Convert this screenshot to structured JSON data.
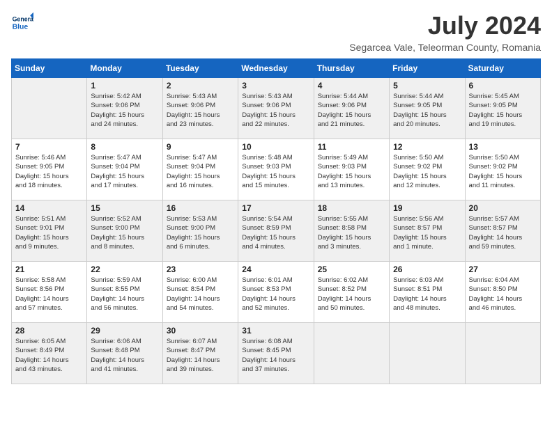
{
  "header": {
    "logo_line1": "General",
    "logo_line2": "Blue",
    "month_year": "July 2024",
    "location": "Segarcea Vale, Teleorman County, Romania"
  },
  "columns": [
    "Sunday",
    "Monday",
    "Tuesday",
    "Wednesday",
    "Thursday",
    "Friday",
    "Saturday"
  ],
  "weeks": [
    {
      "days": [
        {
          "number": "",
          "info": ""
        },
        {
          "number": "1",
          "info": "Sunrise: 5:42 AM\nSunset: 9:06 PM\nDaylight: 15 hours\nand 24 minutes."
        },
        {
          "number": "2",
          "info": "Sunrise: 5:43 AM\nSunset: 9:06 PM\nDaylight: 15 hours\nand 23 minutes."
        },
        {
          "number": "3",
          "info": "Sunrise: 5:43 AM\nSunset: 9:06 PM\nDaylight: 15 hours\nand 22 minutes."
        },
        {
          "number": "4",
          "info": "Sunrise: 5:44 AM\nSunset: 9:06 PM\nDaylight: 15 hours\nand 21 minutes."
        },
        {
          "number": "5",
          "info": "Sunrise: 5:44 AM\nSunset: 9:05 PM\nDaylight: 15 hours\nand 20 minutes."
        },
        {
          "number": "6",
          "info": "Sunrise: 5:45 AM\nSunset: 9:05 PM\nDaylight: 15 hours\nand 19 minutes."
        }
      ]
    },
    {
      "days": [
        {
          "number": "7",
          "info": "Sunrise: 5:46 AM\nSunset: 9:05 PM\nDaylight: 15 hours\nand 18 minutes."
        },
        {
          "number": "8",
          "info": "Sunrise: 5:47 AM\nSunset: 9:04 PM\nDaylight: 15 hours\nand 17 minutes."
        },
        {
          "number": "9",
          "info": "Sunrise: 5:47 AM\nSunset: 9:04 PM\nDaylight: 15 hours\nand 16 minutes."
        },
        {
          "number": "10",
          "info": "Sunrise: 5:48 AM\nSunset: 9:03 PM\nDaylight: 15 hours\nand 15 minutes."
        },
        {
          "number": "11",
          "info": "Sunrise: 5:49 AM\nSunset: 9:03 PM\nDaylight: 15 hours\nand 13 minutes."
        },
        {
          "number": "12",
          "info": "Sunrise: 5:50 AM\nSunset: 9:02 PM\nDaylight: 15 hours\nand 12 minutes."
        },
        {
          "number": "13",
          "info": "Sunrise: 5:50 AM\nSunset: 9:02 PM\nDaylight: 15 hours\nand 11 minutes."
        }
      ]
    },
    {
      "days": [
        {
          "number": "14",
          "info": "Sunrise: 5:51 AM\nSunset: 9:01 PM\nDaylight: 15 hours\nand 9 minutes."
        },
        {
          "number": "15",
          "info": "Sunrise: 5:52 AM\nSunset: 9:00 PM\nDaylight: 15 hours\nand 8 minutes."
        },
        {
          "number": "16",
          "info": "Sunrise: 5:53 AM\nSunset: 9:00 PM\nDaylight: 15 hours\nand 6 minutes."
        },
        {
          "number": "17",
          "info": "Sunrise: 5:54 AM\nSunset: 8:59 PM\nDaylight: 15 hours\nand 4 minutes."
        },
        {
          "number": "18",
          "info": "Sunrise: 5:55 AM\nSunset: 8:58 PM\nDaylight: 15 hours\nand 3 minutes."
        },
        {
          "number": "19",
          "info": "Sunrise: 5:56 AM\nSunset: 8:57 PM\nDaylight: 15 hours\nand 1 minute."
        },
        {
          "number": "20",
          "info": "Sunrise: 5:57 AM\nSunset: 8:57 PM\nDaylight: 14 hours\nand 59 minutes."
        }
      ]
    },
    {
      "days": [
        {
          "number": "21",
          "info": "Sunrise: 5:58 AM\nSunset: 8:56 PM\nDaylight: 14 hours\nand 57 minutes."
        },
        {
          "number": "22",
          "info": "Sunrise: 5:59 AM\nSunset: 8:55 PM\nDaylight: 14 hours\nand 56 minutes."
        },
        {
          "number": "23",
          "info": "Sunrise: 6:00 AM\nSunset: 8:54 PM\nDaylight: 14 hours\nand 54 minutes."
        },
        {
          "number": "24",
          "info": "Sunrise: 6:01 AM\nSunset: 8:53 PM\nDaylight: 14 hours\nand 52 minutes."
        },
        {
          "number": "25",
          "info": "Sunrise: 6:02 AM\nSunset: 8:52 PM\nDaylight: 14 hours\nand 50 minutes."
        },
        {
          "number": "26",
          "info": "Sunrise: 6:03 AM\nSunset: 8:51 PM\nDaylight: 14 hours\nand 48 minutes."
        },
        {
          "number": "27",
          "info": "Sunrise: 6:04 AM\nSunset: 8:50 PM\nDaylight: 14 hours\nand 46 minutes."
        }
      ]
    },
    {
      "days": [
        {
          "number": "28",
          "info": "Sunrise: 6:05 AM\nSunset: 8:49 PM\nDaylight: 14 hours\nand 43 minutes."
        },
        {
          "number": "29",
          "info": "Sunrise: 6:06 AM\nSunset: 8:48 PM\nDaylight: 14 hours\nand 41 minutes."
        },
        {
          "number": "30",
          "info": "Sunrise: 6:07 AM\nSunset: 8:47 PM\nDaylight: 14 hours\nand 39 minutes."
        },
        {
          "number": "31",
          "info": "Sunrise: 6:08 AM\nSunset: 8:45 PM\nDaylight: 14 hours\nand 37 minutes."
        },
        {
          "number": "",
          "info": ""
        },
        {
          "number": "",
          "info": ""
        },
        {
          "number": "",
          "info": ""
        }
      ]
    }
  ]
}
